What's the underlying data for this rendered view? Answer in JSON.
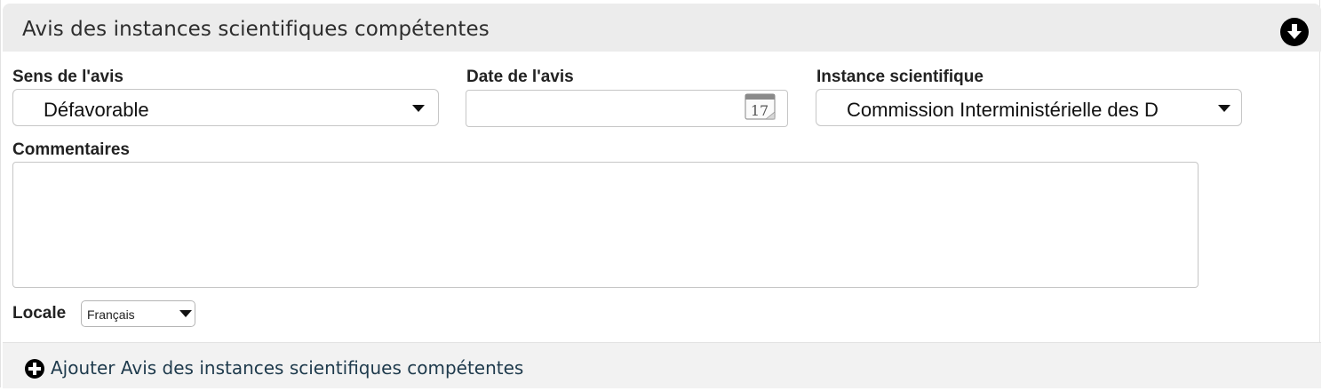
{
  "panel": {
    "title": "Avis des instances scientifiques compétentes",
    "collapse_icon": "chevron-down-circle-icon"
  },
  "form": {
    "sens": {
      "label": "Sens de l'avis",
      "value": "Défavorable"
    },
    "date": {
      "label": "Date de l'avis",
      "value": "",
      "calendar_day": "17",
      "calendar_icon": "calendar-icon"
    },
    "instance": {
      "label": "Instance scientifique",
      "value": "Commission Interministérielle des D"
    },
    "commentaires": {
      "label": "Commentaires",
      "value": ""
    },
    "locale": {
      "label": "Locale",
      "value": "Français"
    }
  },
  "footer": {
    "add_label": "Ajouter Avis des instances scientifiques compétentes",
    "add_icon": "plus-circle-icon"
  }
}
